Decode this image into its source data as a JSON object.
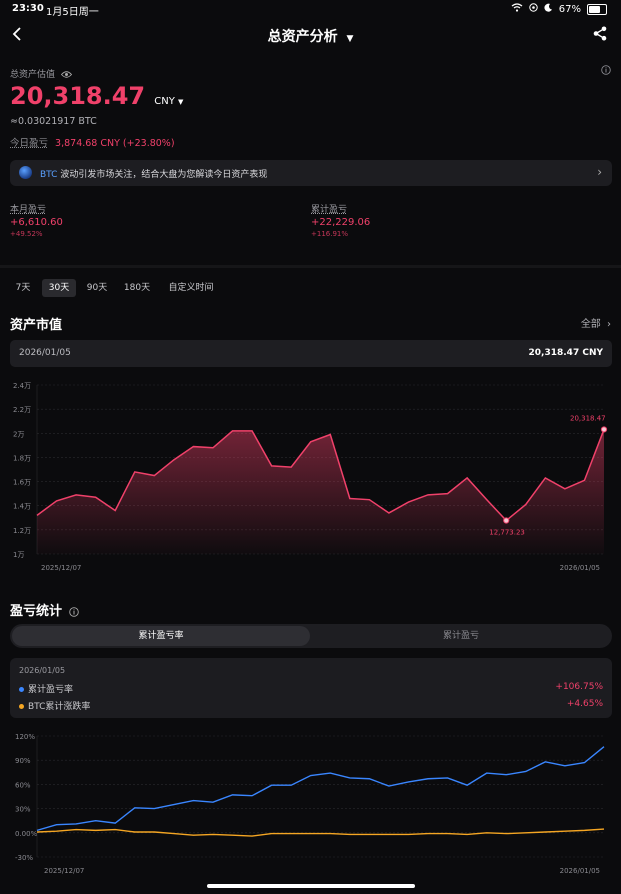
{
  "status_bar": {
    "time": "23:30",
    "date": "1月5日周一",
    "battery": "67%"
  },
  "nav": {
    "title": "总资产分析"
  },
  "summary": {
    "label": "总资产估值",
    "value": "20,318.47",
    "currency": "CNY",
    "btc_equiv": "≈0.03021917 BTC",
    "today_pnl_label": "今日盈亏",
    "today_pnl_value": "3,874.68 CNY (+23.80%)"
  },
  "banner": {
    "prefix": "BTC",
    "text": "波动引发市场关注，结合大盘为您解读今日资产表现"
  },
  "pnl": {
    "month_label": "本月盈亏",
    "month_value": "+6,610.60",
    "month_pct": "+49.52%",
    "total_label": "累计盈亏",
    "total_value": "+22,229.06",
    "total_pct": "+116.91%"
  },
  "ranges": {
    "d7": "7天",
    "d30": "30天",
    "d90": "90天",
    "d180": "180天",
    "custom": "自定义时间"
  },
  "market_value": {
    "title": "资产市值",
    "all": "全部",
    "date": "2026/01/05",
    "value": "20,318.47 CNY"
  },
  "pnl_stats": {
    "title": "盈亏统计",
    "tab_rate": "累计盈亏率",
    "tab_amount": "累计盈亏",
    "date": "2026/01/05",
    "rate_label": "累计盈亏率",
    "rate_value": "+106.75%",
    "btc_label": "BTC累计涨跌率",
    "btc_value": "+4.65%"
  },
  "colors": {
    "accent": "#f0416a",
    "blue": "#3a86ff",
    "orange": "#f5a623",
    "bg": "#0b0b0d"
  },
  "chart_data": [
    {
      "type": "area",
      "x_start": "2025/12/07",
      "x_end": "2026/01/05",
      "y_ticks": [
        "1万",
        "1.2万",
        "1.4万",
        "1.6万",
        "1.8万",
        "2万",
        "2.2万",
        "2.4万"
      ],
      "ylim": [
        10000,
        24000
      ],
      "values": [
        13200,
        14400,
        14900,
        14700,
        13600,
        16800,
        16500,
        17800,
        18900,
        18800,
        20200,
        20200,
        17300,
        17200,
        19300,
        19900,
        14600,
        14500,
        13400,
        14300,
        14900,
        15000,
        16300,
        14500,
        12773.23,
        14100,
        16300,
        15400,
        16100,
        20318.47
      ],
      "max_label": "20,318.47",
      "min_label": "12,773.23"
    },
    {
      "type": "line",
      "x_start": "2025/12/07",
      "x_end": "2026/01/05",
      "y_ticks": [
        "-30%",
        "0.00%",
        "30%",
        "60%",
        "90%",
        "120%"
      ],
      "ylim": [
        -30,
        120
      ],
      "series": [
        {
          "name": "累计盈亏率",
          "values": [
            3,
            10,
            11,
            15,
            12,
            31,
            30,
            35,
            40,
            38,
            47,
            46,
            59,
            59,
            71,
            74,
            68,
            67,
            58,
            63,
            67,
            68,
            59,
            74,
            72,
            76,
            88,
            83,
            87,
            106.75
          ]
        },
        {
          "name": "BTC累计涨跌率",
          "values": [
            1,
            2,
            4,
            3,
            4,
            1,
            1,
            -1,
            -3,
            -2,
            -3,
            -4,
            -1,
            -1,
            -1,
            -1,
            -2,
            -2,
            -2,
            -2,
            -1,
            -1,
            -2,
            0,
            -1,
            0,
            1,
            2,
            3,
            4.65
          ]
        }
      ]
    }
  ]
}
